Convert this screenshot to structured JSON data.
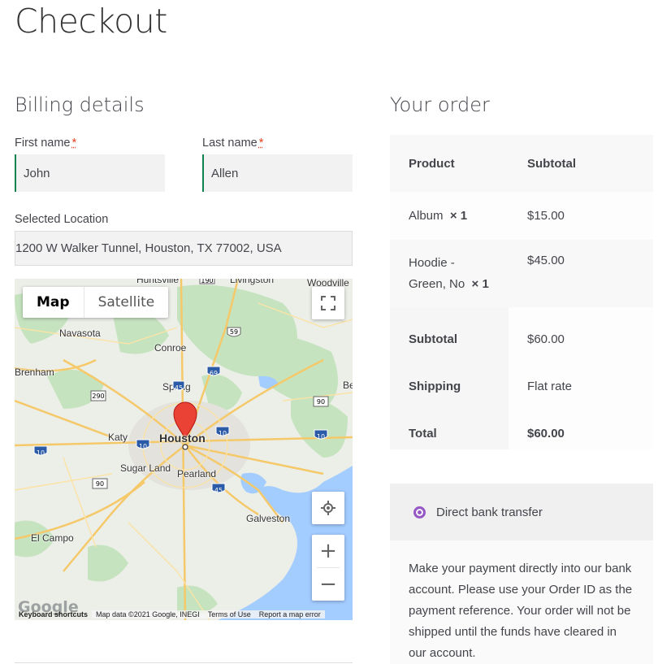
{
  "page": {
    "title": "Checkout"
  },
  "billing": {
    "heading": "Billing details",
    "first_name": {
      "label": "First name",
      "required_mark": "*",
      "value": "John"
    },
    "last_name": {
      "label": "Last name",
      "required_mark": "*",
      "value": "Allen"
    },
    "location": {
      "label": "Selected Location",
      "value": "1200 W Walker Tunnel, Houston, TX 77002, USA"
    }
  },
  "map": {
    "type_buttons": {
      "map": "Map",
      "satellite": "Satellite"
    },
    "places": [
      "Huntsville",
      "Livingston",
      "Woodville",
      "Navasota",
      "Conroe",
      "Brenham",
      "Spring",
      "Katy",
      "Houston",
      "Sugar Land",
      "Pearland",
      "Galveston",
      "El Campo",
      "Be"
    ],
    "highway_shields": [
      "190",
      "59",
      "69",
      "290",
      "45",
      "90",
      "10",
      "10",
      "10",
      "10",
      "90",
      "45"
    ],
    "footer": {
      "keyboard": "Keyboard shortcuts",
      "data": "Map data ©2021 Google, INEGI",
      "terms": "Terms of Use",
      "report": "Report a map error"
    },
    "logo_text": "Google",
    "colors": {
      "water": "#a3ccff",
      "land": "#e8eae4",
      "park": "#c5e3bf",
      "road": "#f8d97f",
      "marker": "#ea4335"
    }
  },
  "order": {
    "heading": "Your order",
    "columns": [
      "Product",
      "Subtotal"
    ],
    "items": [
      {
        "name": "Album",
        "qty": "× 1",
        "price": "$15.00"
      },
      {
        "name_line1": "Hoodie -",
        "name_line2": "Green, No",
        "qty": "× 1",
        "price": "$45.00"
      }
    ],
    "subtotal": {
      "label": "Subtotal",
      "value": "$60.00"
    },
    "shipping": {
      "label": "Shipping",
      "value": "Flat rate"
    },
    "total": {
      "label": "Total",
      "value": "$60.00"
    }
  },
  "payment": {
    "method": "Direct bank transfer",
    "description": "Make your payment directly into our bank account. Please use your Order ID as the payment reference. Your order will not be shipped until the funds have cleared in our account.",
    "desc_lines": [
      "Make your payment directly into our bank",
      "account. Please use your Order ID as the",
      "payment reference. Your order will not be",
      "shipped until the funds have cleared in",
      "our account."
    ],
    "accent_color": "#9658c5"
  }
}
